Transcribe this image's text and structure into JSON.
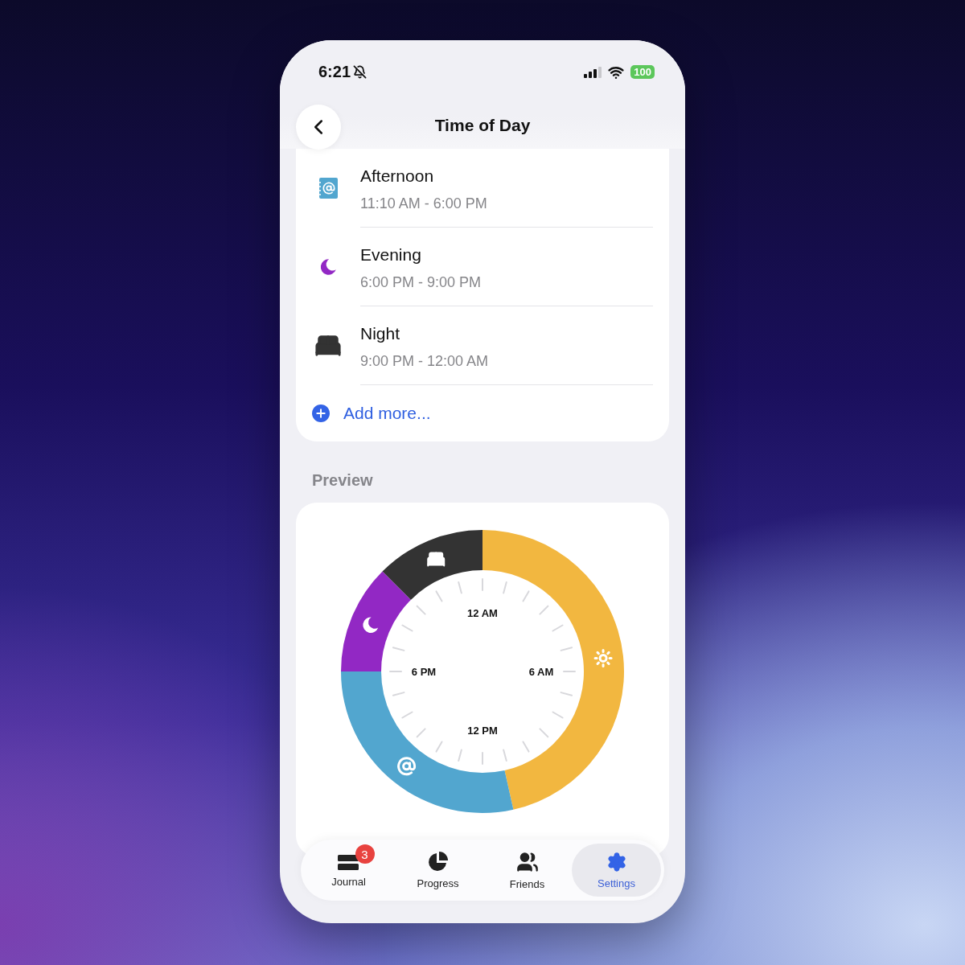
{
  "status_bar": {
    "time": "6:21",
    "battery": "100"
  },
  "header": {
    "title": "Time of Day"
  },
  "rows": [
    {
      "name": "Afternoon",
      "time": "11:10 AM - 6:00 PM",
      "color": "#52a6cf"
    },
    {
      "name": "Evening",
      "time": "6:00 PM - 9:00 PM",
      "color": "#9228c4"
    },
    {
      "name": "Night",
      "time": "9:00 PM - 12:00 AM",
      "color": "#333333"
    }
  ],
  "add_more": "Add more...",
  "preview": {
    "title": "Preview",
    "dial_labels": [
      "12 AM",
      "6 AM",
      "12 PM",
      "6 PM"
    ],
    "segments": [
      {
        "color": "#f2b740"
      },
      {
        "color": "#52a6cf"
      },
      {
        "color": "#9228c4"
      },
      {
        "color": "#333333"
      }
    ],
    "chart_data": {
      "type": "donut",
      "values": [
        46.5,
        28.5,
        12.5,
        12.5
      ]
    }
  },
  "tabs": [
    {
      "label": "Journal",
      "selected": false,
      "badge": "3"
    },
    {
      "label": "Progress",
      "selected": false
    },
    {
      "label": "Friends",
      "selected": false
    },
    {
      "label": "Settings",
      "selected": true
    }
  ]
}
